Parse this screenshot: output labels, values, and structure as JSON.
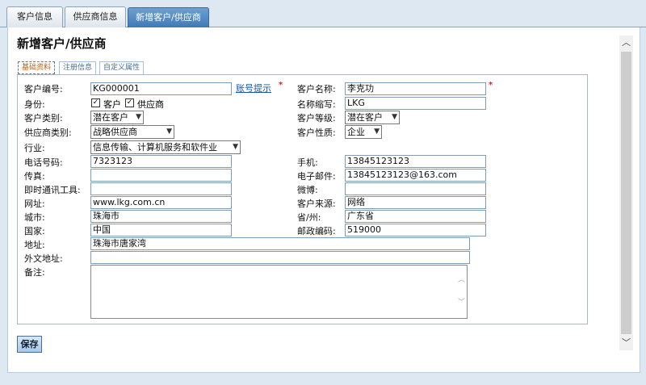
{
  "tabs": [
    {
      "label": "客户信息"
    },
    {
      "label": "供应商信息"
    },
    {
      "label": "新增客户/供应商"
    }
  ],
  "page_title": "新增客户/供应商",
  "subtabs": [
    {
      "label": "基础资料"
    },
    {
      "label": "注册信息"
    },
    {
      "label": "自定义属性"
    }
  ],
  "form": {
    "customer_code": {
      "label": "客户编号:",
      "value": "KG000001",
      "hint_link": "账号提示",
      "required": "*"
    },
    "customer_name": {
      "label": "客户名称:",
      "value": "李克功",
      "required": "*"
    },
    "identity": {
      "label": "身份:",
      "option1": "客户",
      "option2": "供应商"
    },
    "short_name": {
      "label": "名称缩写:",
      "value": "LKG"
    },
    "customer_type": {
      "label": "客户类别:",
      "value": "潜在客户"
    },
    "customer_level": {
      "label": "客户等级:",
      "value": "潜在客户"
    },
    "supplier_type": {
      "label": "供应商类别:",
      "value": "战略供应商"
    },
    "customer_nature": {
      "label": "客户性质:",
      "value": "企业"
    },
    "industry": {
      "label": "行业:",
      "value": "信息传输、计算机服务和软件业"
    },
    "phone": {
      "label": "电话号码:",
      "value": "7323123"
    },
    "mobile": {
      "label": "手机:",
      "value": "13845123123"
    },
    "fax": {
      "label": "传真:",
      "value": ""
    },
    "email": {
      "label": "电子邮件:",
      "value": "13845123123@163.com"
    },
    "im": {
      "label": "即时通讯工具:",
      "value": ""
    },
    "weibo": {
      "label": "微博:",
      "value": ""
    },
    "website": {
      "label": "网址:",
      "value": "www.lkg.com.cn"
    },
    "source": {
      "label": "客户来源:",
      "value": "网络"
    },
    "city": {
      "label": "城市:",
      "value": "珠海市"
    },
    "province": {
      "label": "省/州:",
      "value": "广东省"
    },
    "country": {
      "label": "国家:",
      "value": "中国"
    },
    "postcode": {
      "label": "邮政编码:",
      "value": "519000"
    },
    "address": {
      "label": "地址:",
      "value": "珠海市唐家湾"
    },
    "foreign_address": {
      "label": "外文地址:",
      "value": ""
    },
    "notes": {
      "label": "备注:",
      "value": ""
    }
  },
  "save_label": "保存",
  "colors": {
    "active_tab": "#4a84bf",
    "required": "#d22222",
    "link": "#1a56a8"
  }
}
